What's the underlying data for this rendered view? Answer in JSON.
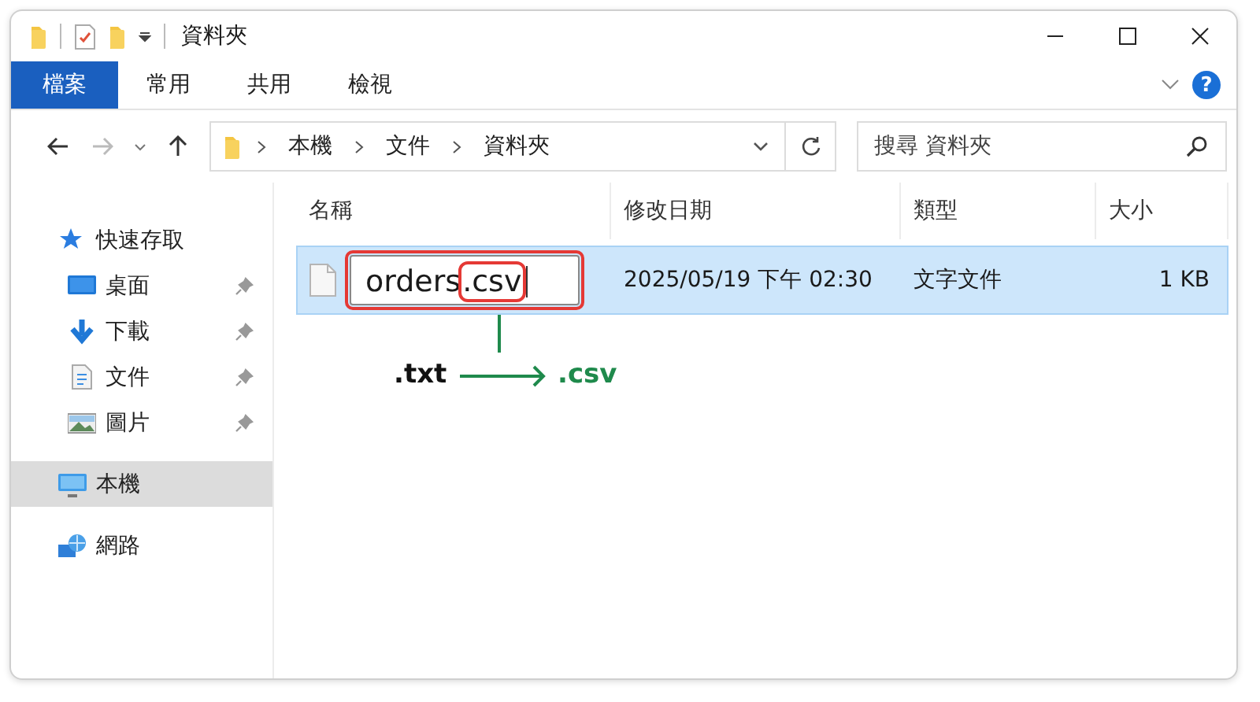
{
  "window": {
    "title": "資料夾"
  },
  "ribbon": {
    "tabs": [
      {
        "label": "檔案",
        "selected": true
      },
      {
        "label": "常用",
        "selected": false
      },
      {
        "label": "共用",
        "selected": false
      },
      {
        "label": "檢視",
        "selected": false
      }
    ],
    "help": "?"
  },
  "navigation": {
    "back_disabled": false,
    "forward_disabled": true
  },
  "address_bar": {
    "path": [
      "本機",
      "文件",
      "資料夾"
    ]
  },
  "search": {
    "placeholder": "搜尋 資料夾"
  },
  "sidebar": {
    "items": [
      {
        "label": "快速存取",
        "kind": "star",
        "selected": false,
        "children": [
          {
            "label": "桌面",
            "kind": "desktop",
            "pinned": true,
            "selected": false
          },
          {
            "label": "下載",
            "kind": "download",
            "pinned": true,
            "selected": false
          },
          {
            "label": "文件",
            "kind": "document",
            "pinned": true,
            "selected": false
          },
          {
            "label": "圖片",
            "kind": "pictures",
            "pinned": true,
            "selected": false
          }
        ]
      },
      {
        "label": "本機",
        "kind": "computer",
        "selected": true
      },
      {
        "label": "網路",
        "kind": "network",
        "selected": false
      }
    ]
  },
  "table": {
    "columns": [
      "名稱",
      "修改日期",
      "類型",
      "大小"
    ],
    "rows": [
      {
        "name": "orders",
        "extension": ".csv",
        "renaming": true,
        "selected": true,
        "modified": "2025/05/19 下午 02:30",
        "type": "文字文件",
        "size": "1 KB"
      }
    ]
  },
  "annotation": {
    "from": ".txt",
    "to": ".csv"
  }
}
